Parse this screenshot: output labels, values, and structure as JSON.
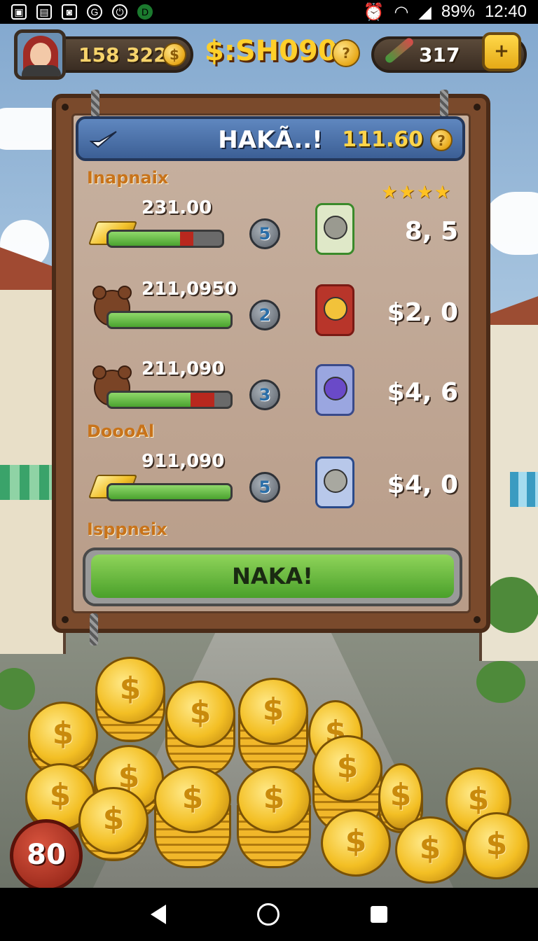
{
  "status_bar": {
    "battery": "89%",
    "time": "12:40"
  },
  "hud": {
    "coins": "158 322",
    "coin_symbol": "$",
    "center_total": "$:SH090",
    "gems": "317",
    "plus_label": "+"
  },
  "panel": {
    "title": "HAKÃ..!",
    "amount": "111.60",
    "section1": "Inapnaix",
    "section2": "DoooAl",
    "section3": "Isppneix",
    "stars": "★★★★",
    "rows": [
      {
        "value": "231.00",
        "level": "5",
        "price": "8, 5",
        "bar_fill": 0.63,
        "bar_red": 0.12
      },
      {
        "value": "211,0950",
        "level": "2",
        "price": "$2, 0",
        "bar_fill": 1.0,
        "bar_red": 0
      },
      {
        "value": "211,090",
        "level": "3",
        "price": "$4, 6",
        "bar_fill": 0.67,
        "bar_red": 0.2
      },
      {
        "value": "911,090",
        "level": "5",
        "price": "$4, 0",
        "bar_fill": 1.0,
        "bar_red": 0
      }
    ],
    "button": "NAKA!"
  },
  "round_counter": "80",
  "colors": {
    "accent": "#4aa02a",
    "title_bar": "#3c5f95",
    "gold": "#f3bf24"
  }
}
